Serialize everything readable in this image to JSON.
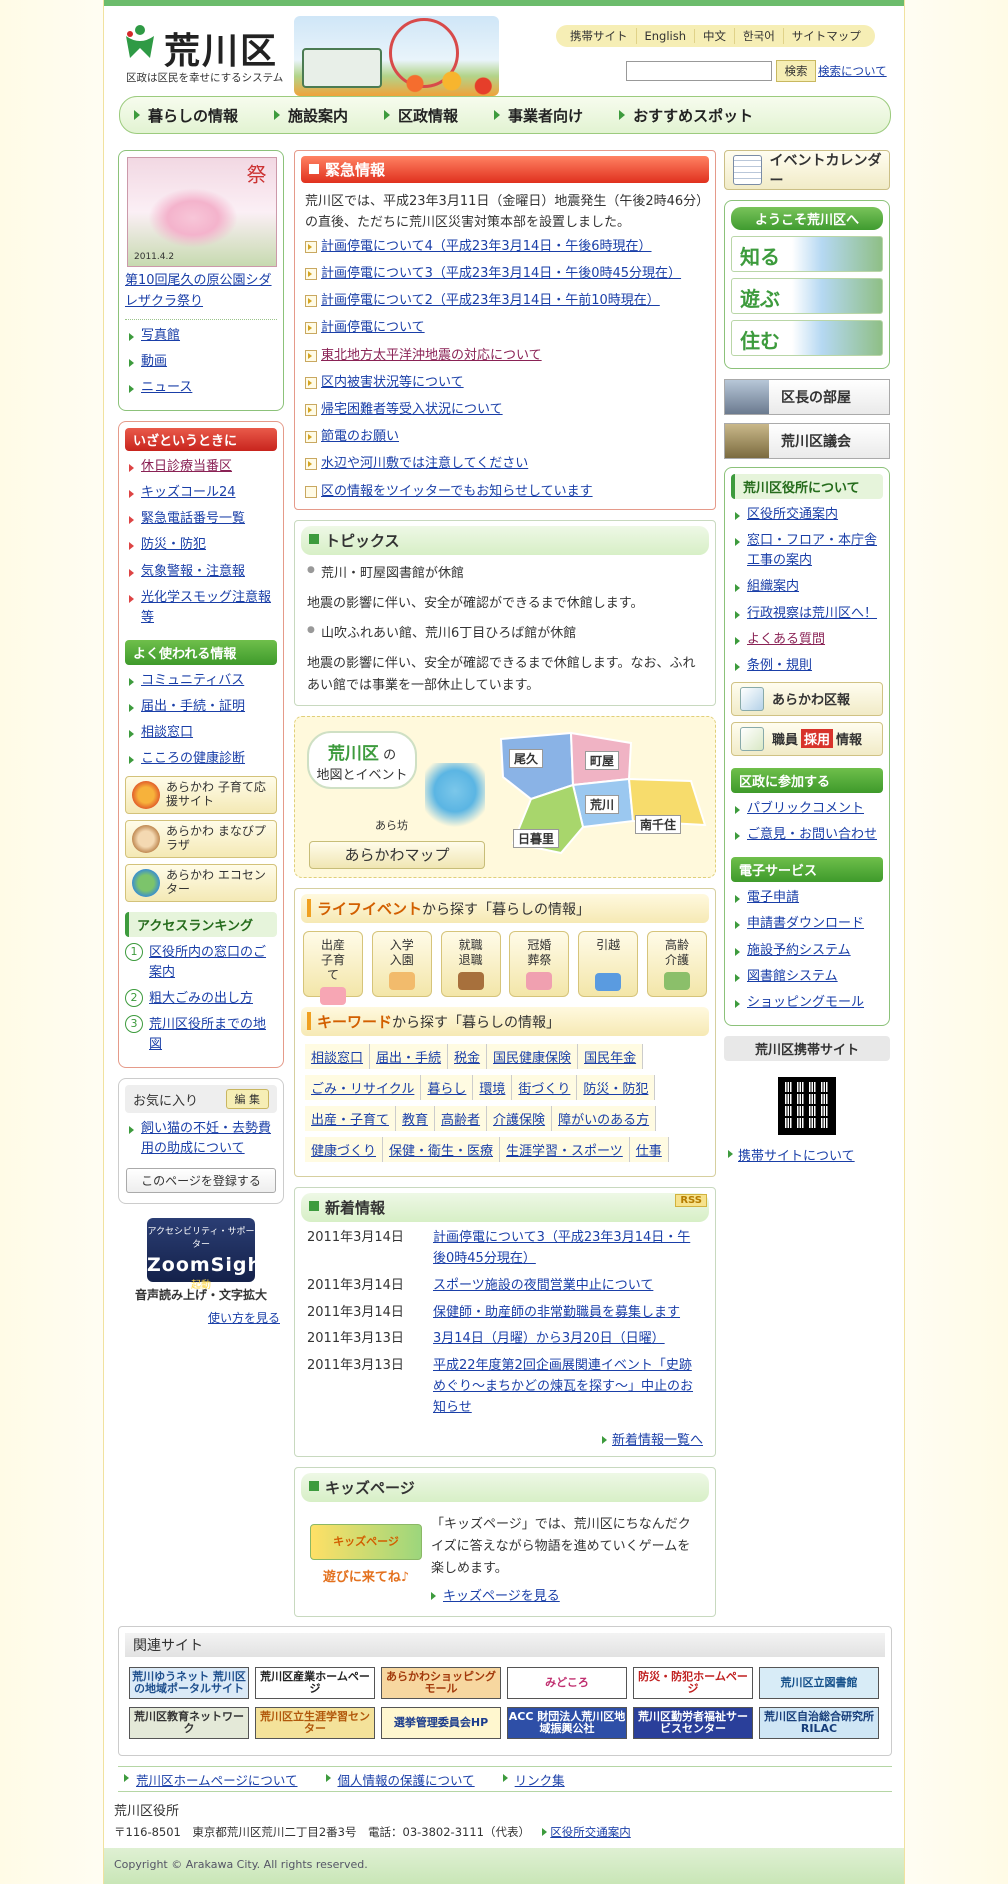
{
  "header": {
    "logo_text": "荒川区",
    "slogan": "区政は区民を幸せにするシステム",
    "util_nav": [
      "携帯サイト",
      "English",
      "中文",
      "한국어",
      "サイトマップ"
    ],
    "search_placeholder": "",
    "search_button": "検索",
    "search_help": "検索について"
  },
  "gnav": [
    "暮らしの情報",
    "施設案内",
    "区政情報",
    "事業者向け",
    "おすすめスポット"
  ],
  "left": {
    "poster_title": "祭",
    "poster_date": "2011.4.2",
    "event_link": "第10回尾久の原公園シダレザクラ祭り",
    "media_links": [
      "写真館",
      "動画",
      "ニュース"
    ],
    "emergency_title": "いざというときに",
    "emergency_links": [
      "休日診療当番区",
      "キッズコール24",
      "緊急電話番号一覧",
      "防災・防犯",
      "気象警報・注意報",
      "光化学スモッグ注意報等"
    ],
    "frequent_title": "よく使われる情報",
    "frequent_links": [
      "コミュニティバス",
      "届出・手続・証明",
      "相談窓口",
      "こころの健康診断"
    ],
    "banners": [
      "あらかわ 子育て応援サイト",
      "あらかわ まなびプラザ",
      "あらかわ エコセンター"
    ],
    "ranking_title": "アクセスランキング",
    "ranking": [
      "区役所内の窓口のご案内",
      "粗大ごみの出し方",
      "荒川区役所までの地図"
    ],
    "fav_title": "お気に入り",
    "fav_edit": "編 集",
    "fav_link": "飼い猫の不妊・去勢費用の助成について",
    "fav_register": "このページを登録する",
    "zoom_top": "アクセシビリティ・サポーター",
    "zoom_name": "ZoomSight",
    "zoom_start": "起動",
    "zoom_caption": "音声読み上げ・文字拡大",
    "zoom_howto": "使い方を見る"
  },
  "center": {
    "urgent_title": "緊急情報",
    "urgent_text": "荒川区では、平成23年3月11日（金曜日）地震発生（午後2時46分）の直後、ただちに荒川区災害対策本部を設置しました。",
    "urgent_links": [
      "計画停電について4（平成23年3月14日・午後6時現在）",
      "計画停電について3（平成23年3月14日・午後0時45分現在）",
      "計画停電について2（平成23年3月14日・午前10時現在）",
      "計画停電について",
      "東北地方太平洋沖地震の対応について",
      "区内被害状況等について",
      "帰宅困難者等受入状況について",
      "節電のお願い",
      "水辺や河川敷では注意してください",
      "区の情報をツイッターでもお知らせしています"
    ],
    "topics_title": "トピックス",
    "topics": [
      {
        "head": "荒川・町屋図書館が休館",
        "body": "地震の影響に伴い、安全が確認ができるまで休館します。"
      },
      {
        "head": "山吹ふれあい館、荒川6丁目ひろば館が休館",
        "body": "地震の影響に伴い、安全が確認できるまで休館します。なお、ふれあい館では事業を一部休止しています。"
      }
    ],
    "map_title_a": "荒川区",
    "map_title_a2": "の",
    "map_title_b": "地図とイベント",
    "map_char": "あら坊",
    "map_button": "あらかわマップ",
    "map_areas": [
      "尾久",
      "町屋",
      "荒川",
      "南千住",
      "日暮里"
    ],
    "life_title": "ライフイベント",
    "life_suffix": "から探す「暮らしの情報」",
    "life_events": [
      "出産 子育て",
      "入学 入園",
      "就職 退職",
      "冠婚 葬祭",
      "引越",
      "高齢 介護"
    ],
    "kw_title": "キーワード",
    "kw_suffix": "から探す「暮らしの情報」",
    "keywords": [
      "相談窓口",
      "届出・手続",
      "税金",
      "国民健康保険",
      "国民年金",
      "ごみ・リサイクル",
      "暮らし",
      "環境",
      "街づくり",
      "防災・防犯",
      "出産・子育て",
      "教育",
      "高齢者",
      "介護保険",
      "障がいのある方",
      "健康づくり",
      "保健・衛生・医療",
      "生涯学習・スポーツ",
      "仕事"
    ],
    "news_title": "新着情報",
    "news_rss": "RSS",
    "news": [
      {
        "date": "2011年3月14日",
        "title": "計画停電について3（平成23年3月14日・午後0時45分現在）"
      },
      {
        "date": "2011年3月14日",
        "title": "スポーツ施設の夜間営業中止について"
      },
      {
        "date": "2011年3月14日",
        "title": "保健師・助産師の非常勤職員を募集します"
      },
      {
        "date": "2011年3月13日",
        "title": "3月14日（月曜）から3月20日（日曜）"
      },
      {
        "date": "2011年3月13日",
        "title": "平成22年度第2回企画展関連イベント「史跡めぐり～まちかどの煉瓦を探す～」中止のお知らせ"
      }
    ],
    "news_more": "新着情報一覧へ",
    "kids_title": "キッズページ",
    "kids_logo": "キッズページ",
    "kids_tagline": "遊びに来てね♪",
    "kids_text": "「キッズページ」では、荒川区にちなんだクイズに答えながら物語を進めていくゲームを楽しめます。",
    "kids_link": "キッズページを見る"
  },
  "right": {
    "calendar": "イベントカレンダー",
    "welcome_title": "ようこそ荒川区へ",
    "welcome_tiles": [
      "知る",
      "遊ぶ",
      "住む"
    ],
    "mayor": "区長の部屋",
    "council": "荒川区議会",
    "office_title": "荒川区役所について",
    "office_links": [
      "区役所交通案内",
      "窓口・フロア・本庁舎工事の案内",
      "組織案内",
      "行政視察は荒川区へ！",
      "よくある質問",
      "条例・規則"
    ],
    "pr_button": "あらかわ区報",
    "recruit_a": "職員",
    "recruit_b": "採用",
    "recruit_c": "情報",
    "participate_title": "区政に参加する",
    "participate_links": [
      "パブリックコメント",
      "ご意見・お問い合わせ"
    ],
    "eservice_title": "電子サービス",
    "eservice_links": [
      "電子申請",
      "申請書ダウンロード",
      "施設予約システム",
      "図書館システム",
      "ショッピングモール"
    ],
    "mobile_title": "荒川区携帯サイト",
    "mobile_link": "携帯サイトについて"
  },
  "related": {
    "title": "関連サイト",
    "sites": [
      "荒川ゆうネット 荒川区の地域ポータルサイト",
      "荒川区産業ホームページ",
      "あらかわショッピングモール",
      "みどころ",
      "防災・防犯ホームページ",
      "荒川区立図書館",
      "荒川区教育ネットワーク",
      "荒川区立生涯学習センター",
      "選挙管理委員会HP",
      "ACC 財団法人荒川区地域振興公社",
      "荒川区勤労者福祉サービスセンター",
      "荒川区自治総合研究所 RILAC"
    ]
  },
  "footer": {
    "links": [
      "荒川区ホームページについて",
      "個人情報の保護について",
      "リンク集"
    ],
    "office": "荒川区役所",
    "address": "〒116-8501　東京都荒川区荒川二丁目2番3号　電話：03-3802-3111（代表）",
    "address_link": "区役所交通案内",
    "copyright": "Copyright © Arakawa City. All rights reserved."
  },
  "colors": {
    "brand_green": "#3d9b3d",
    "urgent_red": "#e0301e",
    "link": "#1a3fa8"
  }
}
